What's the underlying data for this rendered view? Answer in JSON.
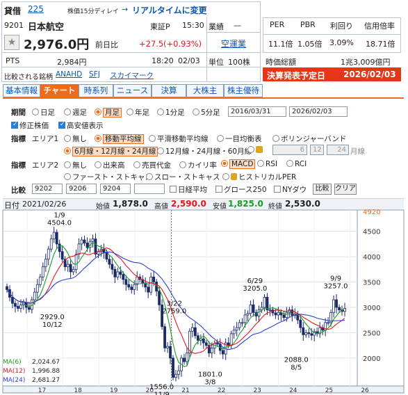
{
  "header": {
    "kashaku_label": "貸借",
    "page_number": "225",
    "delay_note": "株価15分ディレイ",
    "arrow": "→",
    "realtime_link": "リアルタイムに変更",
    "code": "9201",
    "name": "日本航空",
    "market": "東証P",
    "time": "15:30",
    "gyoshu_label": "業績",
    "gyoshu_value": "—",
    "sector": "空運業",
    "price": "2,976.0円",
    "prev_label": "前日比",
    "change": "+27.5",
    "change_pct": "(+0.93%)",
    "pts_label": "PTS",
    "pts_price": "2,984円",
    "pts_time": "18:20",
    "pts_date": "02/03",
    "unit_label": "単位",
    "unit_value": "100株",
    "compare_label": "比較される銘柄",
    "compare_links": [
      "ANAHD",
      "SFJ",
      "スカイマーク"
    ]
  },
  "metrics": {
    "labels": [
      "PER",
      "PBR",
      "利回り",
      "信用倍率"
    ],
    "values": [
      "11.1倍",
      "1.05倍",
      "3.09%",
      "18.71倍"
    ],
    "market_cap_label": "時価総額",
    "market_cap_value": "1兆3,009億円",
    "earnings_label": "決算発表予定日",
    "earnings_date": "2026/02/03"
  },
  "tabs": [
    "基本情報",
    "チャート",
    "時系列",
    "ニュース",
    "決算",
    "大株主",
    "株主優待"
  ],
  "controls": {
    "period_label": "期間",
    "periods": [
      "日足",
      "週足",
      "月足",
      "年足",
      "1分足",
      "5分足"
    ],
    "period_selected": "月足",
    "date_from": "2016/03/31",
    "date_to": "2026/02/03",
    "adjusted": "修正株価",
    "high_low": "高安値表示",
    "indicator_label": "指標",
    "area1_label": "エリア1",
    "area1_opts": [
      "無し",
      "移動平均線",
      "平滑移動平均線",
      "一目均衡表",
      "ボリンジャーバンド"
    ],
    "ma_opts": [
      "6月線・12月線・24月線",
      "12月線・24月線・60月線"
    ],
    "ma_custom": [
      "6",
      "12",
      "24"
    ],
    "ma_custom_unit": "月線",
    "area2_label": "エリア2",
    "area2_opts": [
      "無し",
      "出来高",
      "売買代金",
      "カイリ率",
      "MACD",
      "RSI",
      "RCI"
    ],
    "area2_opts2": [
      "ファースト・ストキャス",
      "スロー・ストキャス",
      "ヒストリカルPER"
    ],
    "compare_label": "比較",
    "compare_codes": [
      "9202",
      "9206",
      "9204",
      ""
    ],
    "compare_opts": [
      "日経平均",
      "グロース250",
      "NYダウ"
    ],
    "compare_btn": "比較",
    "clear_btn": "クリア"
  },
  "ohlc": {
    "date_label": "日付",
    "date": "2021/02/26",
    "open_label": "始値",
    "open": "1,878.0",
    "high_label": "高値",
    "high": "2,590.0",
    "low_label": "安値",
    "low": "1,825.0",
    "close_label": "終値",
    "close": "2,530.0"
  },
  "ma_legend": [
    {
      "label": "MA(6)",
      "value": "2,024.67",
      "color": "#1a9a28"
    },
    {
      "label": "MA(12)",
      "value": "1,996.88",
      "color": "#e5161c"
    },
    {
      "label": "MA(24)",
      "value": "2,681.27",
      "color": "#2b3fd8"
    }
  ],
  "chart_data": {
    "type": "candlestick",
    "x_ticks": [
      "17",
      "18",
      "19",
      "20",
      "21",
      "22",
      "23",
      "24",
      "25",
      "26"
    ],
    "y_ticks": [
      2000,
      2500,
      3000,
      3500,
      4000,
      4500
    ],
    "y_top_label": "4920",
    "ylim": [
      1450,
      4920
    ],
    "annotations": [
      {
        "text1": "1/9",
        "text2": "4504.0",
        "x": 2018.0,
        "y": 4504
      },
      {
        "text1": "2929.0",
        "text2": "10/12",
        "x": 2017.8,
        "y": 2929
      },
      {
        "text1": "3/22",
        "text2": "2759.0",
        "x": 2021.2,
        "y": 2759
      },
      {
        "text1": "1556.0",
        "text2": "11/9",
        "x": 2020.85,
        "y": 1556
      },
      {
        "text1": "1801.0",
        "text2": "3/8",
        "x": 2022.2,
        "y": 1801
      },
      {
        "text1": "6/29",
        "text2": "3205.0",
        "x": 2023.45,
        "y": 3205
      },
      {
        "text1": "2088.0",
        "text2": "8/5",
        "x": 2024.6,
        "y": 2088
      },
      {
        "text1": "9/9",
        "text2": "3257.0",
        "x": 2025.7,
        "y": 3257
      }
    ],
    "close": [
      3350,
      3200,
      3080,
      3020,
      2980,
      3050,
      3100,
      3000,
      2960,
      3150,
      3300,
      3450,
      3600,
      3800,
      3950,
      4150,
      4350,
      4480,
      4250,
      4100,
      3950,
      3800,
      3850,
      3700,
      3750,
      4050,
      4250,
      4330,
      4270,
      4180,
      4300,
      4350,
      4050,
      4100,
      4150,
      4080,
      3950,
      3850,
      3750,
      3600,
      3700,
      3650,
      3550,
      3450,
      3400,
      3350,
      3450,
      3600,
      3550,
      3480,
      3400,
      3300,
      3600,
      3500,
      3320,
      3050,
      2620,
      2200,
      2230,
      2000,
      1620,
      1680,
      1750,
      2000,
      1930,
      2100,
      2530,
      2600,
      2440,
      2350,
      2380,
      2300,
      2250,
      2100,
      2200,
      2290,
      2280,
      2150,
      2080,
      2300,
      2250,
      2480,
      2550,
      2600,
      2700,
      2700,
      2850,
      2880,
      3050,
      2900,
      2830,
      2950,
      3000,
      3200,
      2950,
      2950,
      2890,
      2850,
      2900,
      2850,
      2800,
      2900,
      2950,
      2840,
      2870,
      2750,
      2600,
      2460,
      2500,
      2480,
      2450,
      2520,
      2480,
      2600,
      2550,
      2700,
      2700,
      2900,
      3150,
      3000,
      2950,
      2920,
      2980
    ]
  }
}
